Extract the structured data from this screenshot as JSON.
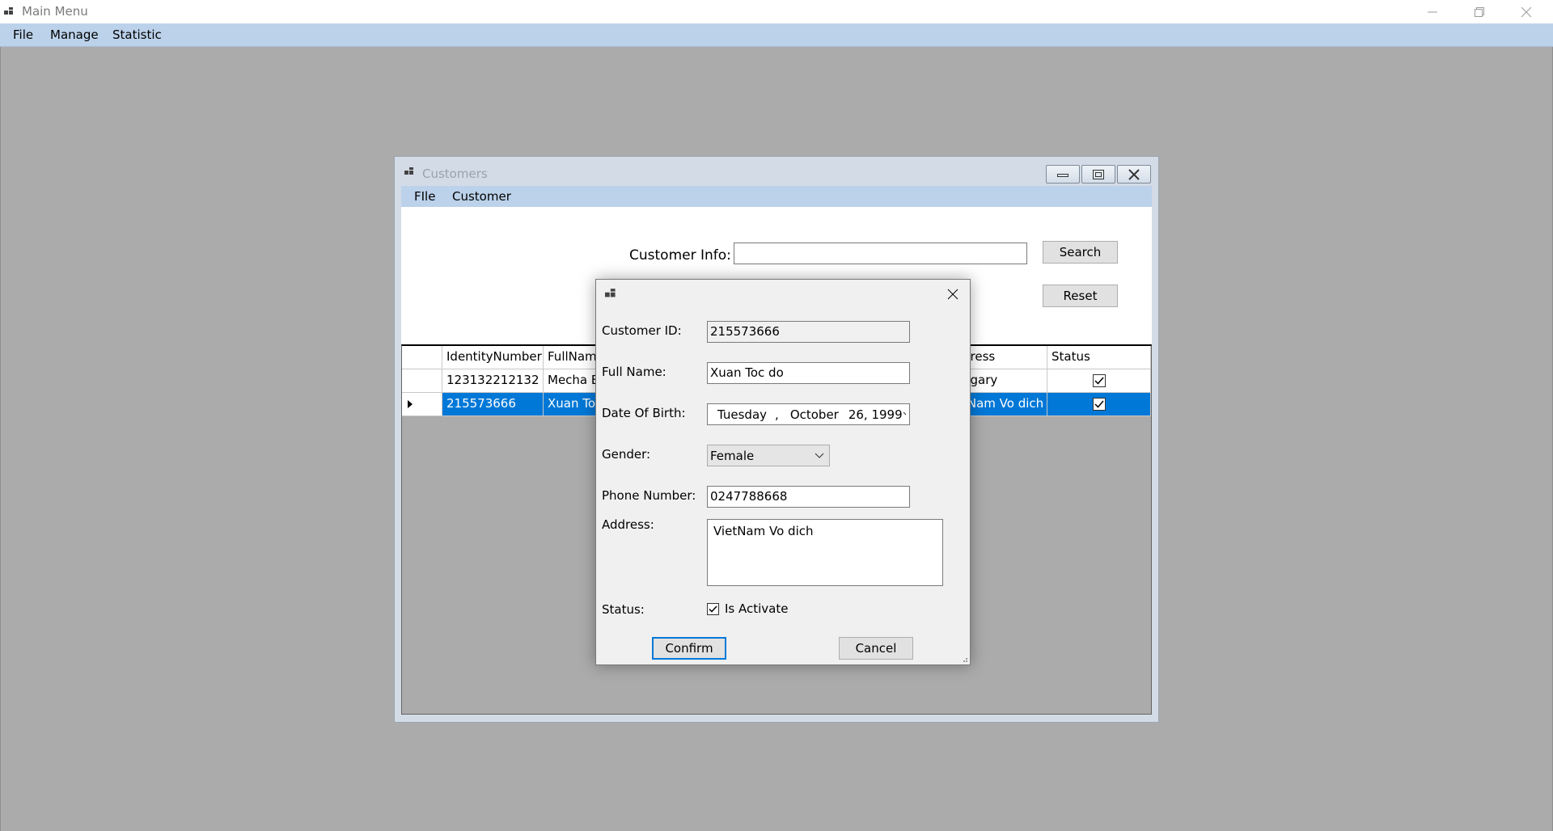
{
  "main": {
    "title": "Main Menu",
    "menu": [
      "File",
      "Manage",
      "Statistic"
    ]
  },
  "customers": {
    "title": "Customers",
    "menu": [
      "FIle",
      "Customer"
    ],
    "info_label": "Customer Info:",
    "search_value": "",
    "search_label": "Search",
    "reset_label": "Reset",
    "grid": {
      "columns": [
        "IdentityNumber",
        "FullNam",
        "dress",
        "Status"
      ],
      "rows": [
        {
          "id": "123132212132",
          "name": "Mecha El",
          "address": "ngary",
          "status": true,
          "selected": false
        },
        {
          "id": "215573666",
          "name": "Xuan Toc",
          "address": "tNam Vo dich",
          "status": true,
          "selected": true
        }
      ]
    }
  },
  "dialog": {
    "labels": {
      "customer_id": "Customer ID:",
      "full_name": "Full Name:",
      "dob": "Date Of Birth:",
      "gender": "Gender:",
      "phone": "Phone Number:",
      "address": "Address:",
      "status": "Status:"
    },
    "values": {
      "customer_id": "215573666",
      "full_name": "Xuan Toc do",
      "dob_day": "Tuesday",
      "dob_sep": ",",
      "dob_month": "October",
      "dob_date": "26, 1999",
      "gender": "Female",
      "phone": "0247788668",
      "address": "VietNam Vo dich"
    },
    "status_checkbox_label": "Is Activate",
    "status_checked": true,
    "confirm_label": "Confirm",
    "cancel_label": "Cancel"
  },
  "colors": {
    "menubar": "#bcd2ea",
    "selection": "#0078d7",
    "mdi_background": "#ababab"
  }
}
